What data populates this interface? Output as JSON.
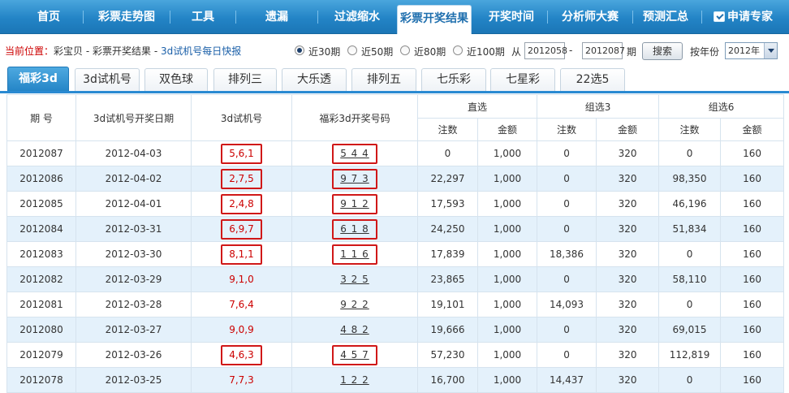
{
  "nav": {
    "items": [
      "首页",
      "彩票走势图",
      "工具",
      "遗漏",
      "过滤缩水",
      "彩票开奖结果",
      "开奖时间",
      "分析师大赛",
      "预测汇总"
    ],
    "active_index": 5,
    "apply_label": "申请专家"
  },
  "breadcrumb": {
    "prefix": "当前位置：",
    "home": "彩宝贝",
    "sep": " - ",
    "section": "彩票开奖结果",
    "current": "3d试机号每日快报"
  },
  "filters": {
    "periods": [
      "近30期",
      "近50期",
      "近80期",
      "近100期"
    ],
    "selected_period": 0,
    "from_label": "从",
    "from_value": "2012058",
    "dash": "-",
    "to_value": "2012087",
    "period_suffix": "期",
    "search_label": "搜索",
    "year_label": "按年份",
    "year_value": "2012年"
  },
  "tabs": {
    "items": [
      "福彩3d",
      "3d试机号",
      "双色球",
      "排列三",
      "大乐透",
      "排列五",
      "七乐彩",
      "七星彩",
      "22选5"
    ],
    "active_index": 0
  },
  "table": {
    "headers": {
      "issue": "期 号",
      "date": "3d试机号开奖日期",
      "trial": "3d试机号",
      "winning": "福彩3d开奖号码",
      "direct": "直选",
      "group3": "组选3",
      "group6": "组选6",
      "count": "注数",
      "amount": "金额"
    },
    "rows": [
      {
        "issue": "2012087",
        "date": "2012-04-03",
        "trial": "5,6,1",
        "winning": "5 4 4",
        "direct_count": "0",
        "direct_amount": "1,000",
        "g3_count": "0",
        "g3_amount": "320",
        "g6_count": "0",
        "g6_amount": "160",
        "highlighted": true
      },
      {
        "issue": "2012086",
        "date": "2012-04-02",
        "trial": "2,7,5",
        "winning": "9 7 3",
        "direct_count": "22,297",
        "direct_amount": "1,000",
        "g3_count": "0",
        "g3_amount": "320",
        "g6_count": "98,350",
        "g6_amount": "160",
        "highlighted": true
      },
      {
        "issue": "2012085",
        "date": "2012-04-01",
        "trial": "2,4,8",
        "winning": "9 1 2",
        "direct_count": "17,593",
        "direct_amount": "1,000",
        "g3_count": "0",
        "g3_amount": "320",
        "g6_count": "46,196",
        "g6_amount": "160",
        "highlighted": true
      },
      {
        "issue": "2012084",
        "date": "2012-03-31",
        "trial": "6,9,7",
        "winning": "6 1 8",
        "direct_count": "24,250",
        "direct_amount": "1,000",
        "g3_count": "0",
        "g3_amount": "320",
        "g6_count": "51,834",
        "g6_amount": "160",
        "highlighted": true
      },
      {
        "issue": "2012083",
        "date": "2012-03-30",
        "trial": "8,1,1",
        "winning": "1 1 6",
        "direct_count": "17,839",
        "direct_amount": "1,000",
        "g3_count": "18,386",
        "g3_amount": "320",
        "g6_count": "0",
        "g6_amount": "160",
        "highlighted": true
      },
      {
        "issue": "2012082",
        "date": "2012-03-29",
        "trial": "9,1,0",
        "winning": "3 2 5",
        "direct_count": "23,865",
        "direct_amount": "1,000",
        "g3_count": "0",
        "g3_amount": "320",
        "g6_count": "58,110",
        "g6_amount": "160",
        "highlighted": false
      },
      {
        "issue": "2012081",
        "date": "2012-03-28",
        "trial": "7,6,4",
        "winning": "9 2 2",
        "direct_count": "19,101",
        "direct_amount": "1,000",
        "g3_count": "14,093",
        "g3_amount": "320",
        "g6_count": "0",
        "g6_amount": "160",
        "highlighted": false
      },
      {
        "issue": "2012080",
        "date": "2012-03-27",
        "trial": "9,0,9",
        "winning": "4 8 2",
        "direct_count": "19,666",
        "direct_amount": "1,000",
        "g3_count": "0",
        "g3_amount": "320",
        "g6_count": "69,015",
        "g6_amount": "160",
        "highlighted": false
      },
      {
        "issue": "2012079",
        "date": "2012-03-26",
        "trial": "4,6,3",
        "winning": "4 5 7",
        "direct_count": "57,230",
        "direct_amount": "1,000",
        "g3_count": "0",
        "g3_amount": "320",
        "g6_count": "112,819",
        "g6_amount": "160",
        "highlighted": true
      },
      {
        "issue": "2012078",
        "date": "2012-03-25",
        "trial": "7,7,3",
        "winning": "1 2 2",
        "direct_count": "16,700",
        "direct_amount": "1,000",
        "g3_count": "14,437",
        "g3_amount": "320",
        "g6_count": "0",
        "g6_amount": "160",
        "highlighted": false
      }
    ]
  },
  "colors": {
    "nav_blue": "#2384c6",
    "trial_red": "#cc0000",
    "highlight_box": "#d01818",
    "row_alt": "#e4f1fb"
  }
}
